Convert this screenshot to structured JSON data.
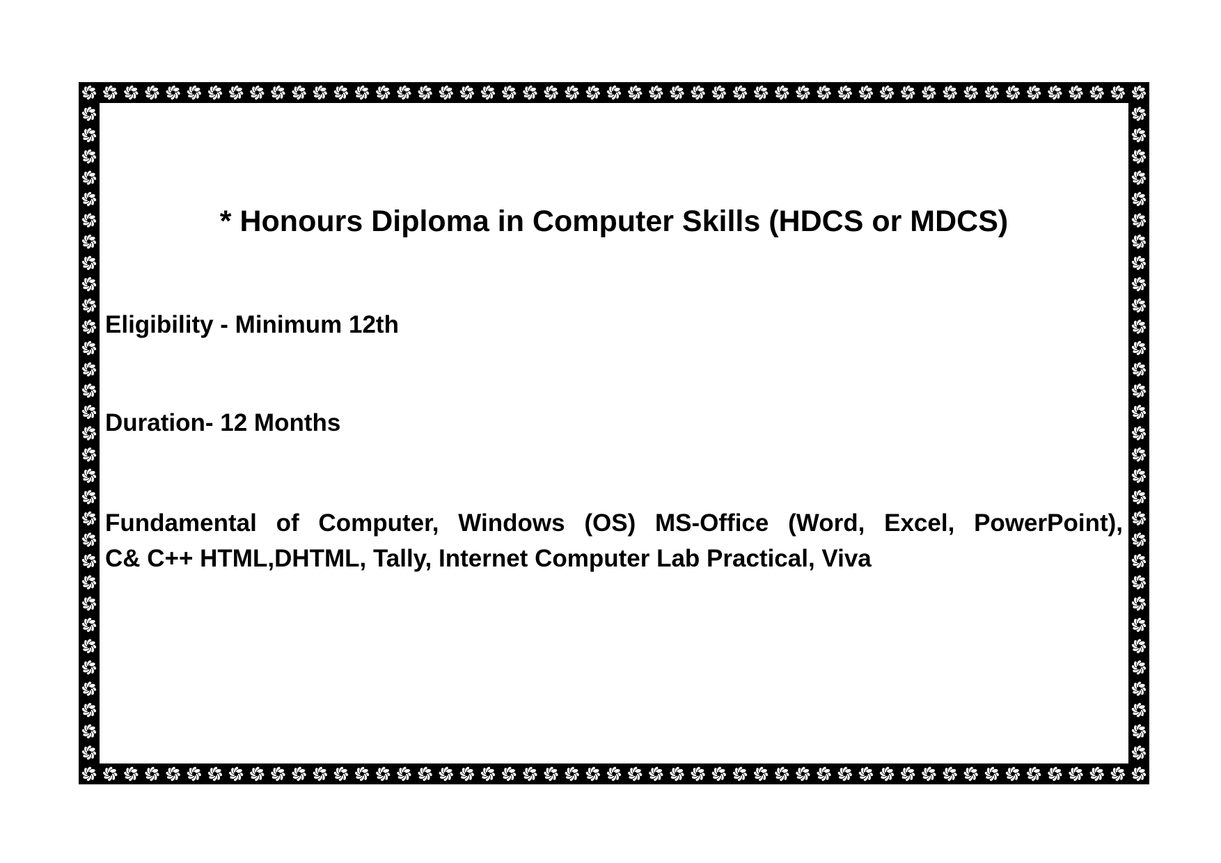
{
  "document": {
    "title": "* Honours Diploma in Computer Skills (HDCS or MDCS)",
    "eligibility": "Eligibility - Minimum 12th",
    "duration": "Duration- 12 Months",
    "syllabus_lines": [
      "Fundamental of Computer, Windows (OS) MS-Office (Word, Excel, PowerPoint),",
      "C& C++ HTML,DHTML, Tally, Internet Computer Lab Practical, Viva"
    ]
  },
  "border": {
    "frame_color": "#000000",
    "ornament_color": "#ffffff",
    "ornament": "flower-ornament-icon"
  }
}
